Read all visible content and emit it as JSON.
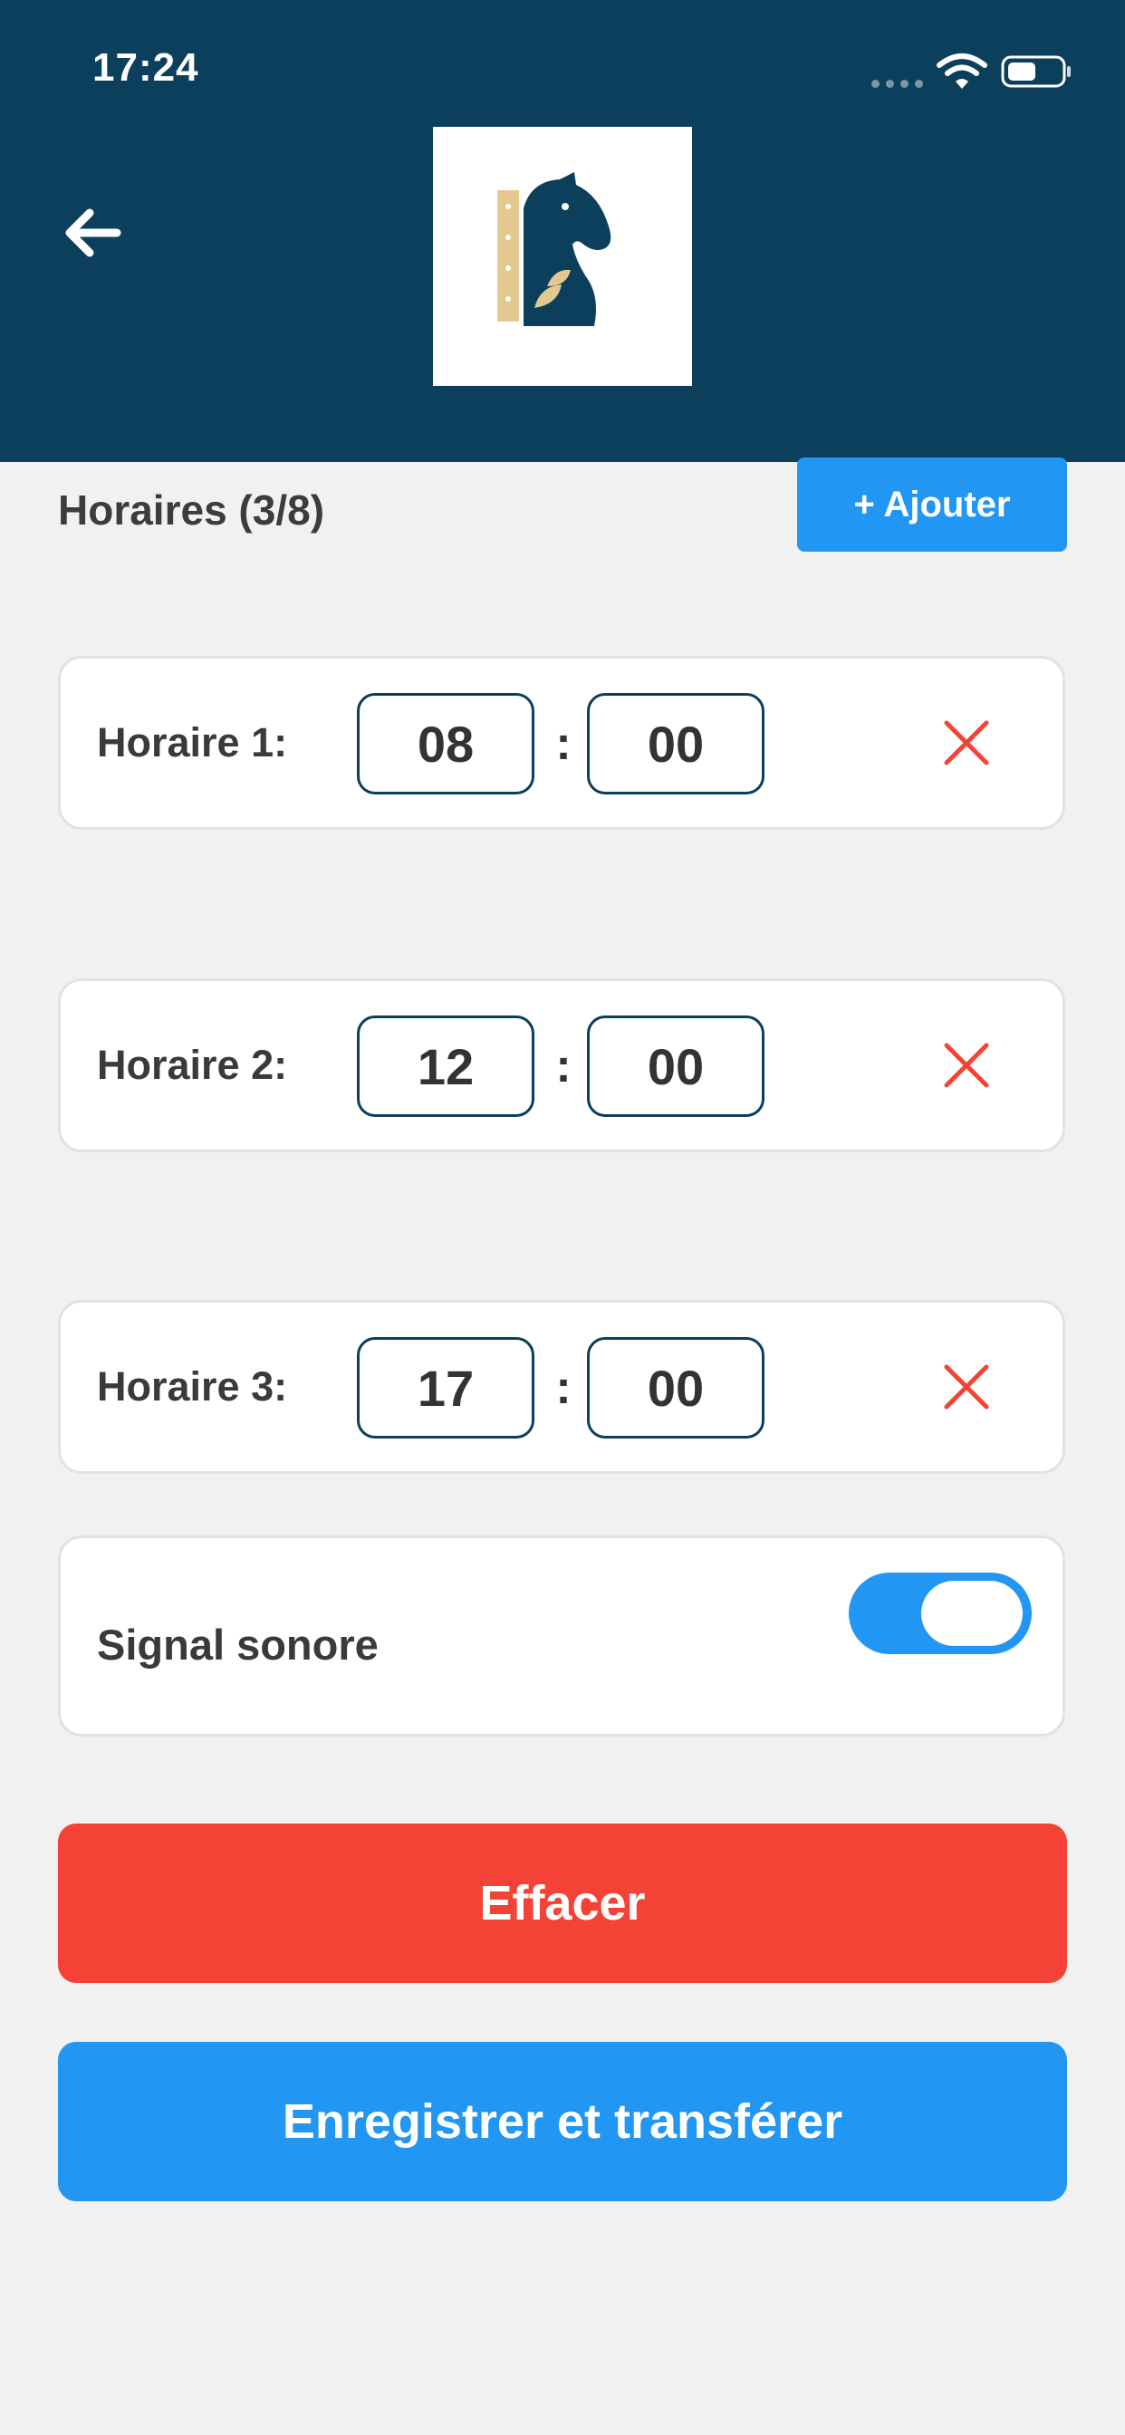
{
  "status_bar": {
    "time": "17:24"
  },
  "header": {
    "background": "#0b3f5c",
    "back_icon": "arrow-left-icon",
    "logo_icon": "horse-head-logo-icon"
  },
  "schedule": {
    "title": "Horaires (3/8)",
    "add_label": "+ Ajouter",
    "separator": ":",
    "slots": [
      {
        "label": "Horaire 1:",
        "hours": "08",
        "minutes": "00"
      },
      {
        "label": "Horaire 2:",
        "hours": "12",
        "minutes": "00"
      },
      {
        "label": "Horaire 3:",
        "hours": "17",
        "minutes": "00"
      }
    ]
  },
  "signal": {
    "label": "Signal sonore",
    "enabled": true
  },
  "actions": {
    "clear_label": "Effacer",
    "save_label": "Enregistrer et transférer"
  },
  "colors": {
    "brand": "#0b3f5c",
    "accent": "#2196f3",
    "danger": "#f44336",
    "logo_gold": "#e3c98f"
  }
}
